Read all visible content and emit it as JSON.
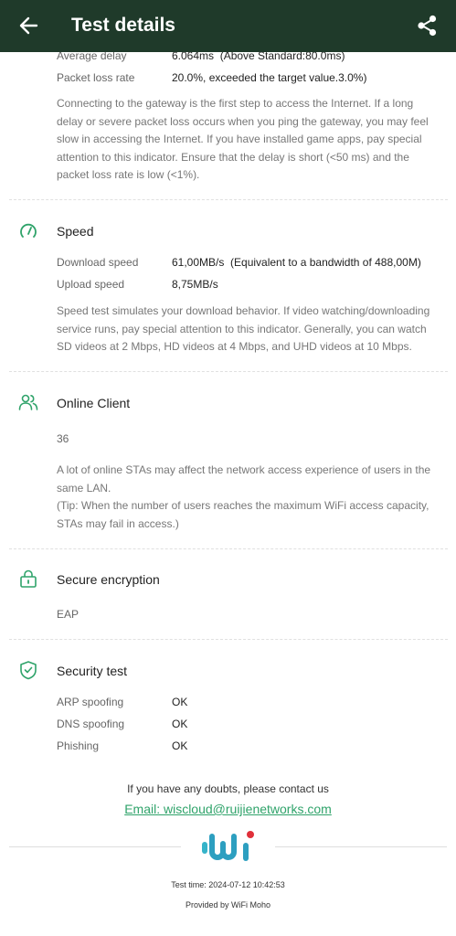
{
  "header": {
    "title": "Test details",
    "back_icon": "arrow-left-icon",
    "share_icon": "share-icon"
  },
  "gateway": {
    "rows": [
      {
        "label": "Average delay",
        "value": "6.064ms  (Above Standard:80.0ms)"
      },
      {
        "label": "Packet loss rate",
        "value": "20.0%, exceeded the target value.3.0%)"
      }
    ],
    "desc": "Connecting to the gateway is the first step to access the Internet. If a long delay or severe packet loss occurs when you ping the gateway, you may feel slow in accessing the Internet. If you have installed game apps, pay special attention to this indicator. Ensure that the delay is short (<50 ms) and the packet loss rate is low (<1%)."
  },
  "speed": {
    "title": "Speed",
    "icon": "speedometer-icon",
    "rows": [
      {
        "label": "Download speed",
        "value": "61,00MB/s  (Equivalent to a bandwidth of 488,00M)"
      },
      {
        "label": "Upload speed",
        "value": "8,75MB/s"
      }
    ],
    "desc": "Speed test simulates your download behavior. If video watching/downloading service runs, pay special attention to this indicator. Generally, you can watch SD videos at 2 Mbps, HD videos at 4 Mbps, and UHD videos at 10 Mbps."
  },
  "online_client": {
    "title": "Online Client",
    "icon": "users-icon",
    "value": "36",
    "desc_line1": "A lot of online STAs may affect the network access experience of users in the same LAN.",
    "desc_line2": "(Tip: When the number of users reaches the maximum WiFi access capacity, STAs may fail in access.)"
  },
  "encryption": {
    "title": "Secure encryption",
    "icon": "lock-icon",
    "value": "EAP"
  },
  "security": {
    "title": "Security test",
    "icon": "shield-check-icon",
    "rows": [
      {
        "label": "ARP spoofing",
        "value": "OK"
      },
      {
        "label": "DNS spoofing",
        "value": "OK"
      },
      {
        "label": "Phishing",
        "value": "OK"
      }
    ]
  },
  "footer": {
    "contact": "If you have any doubts, please contact us",
    "email": "Email: wiscloud@ruijienetworks.com",
    "logo_text": "Wi",
    "test_time": "Test time: 2024-07-12 10:42:53",
    "provided_by": "Provided by WiFi Moho"
  },
  "colors": {
    "header_bg": "#1f3a2a",
    "accent": "#2fa36a",
    "logo_red": "#e0303a"
  }
}
